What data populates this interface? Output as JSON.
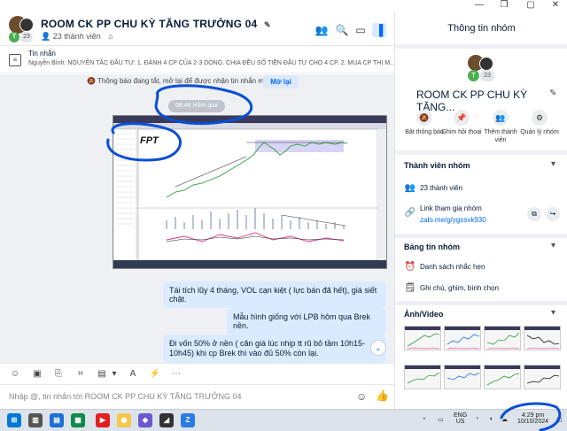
{
  "chat": {
    "title": "ROOM CK PP CHU KỲ TĂNG TRƯỞNG 04",
    "avatar_initial": "T",
    "avatar_count": "23",
    "member_count": "23 thành viên",
    "pinned_title": "Tin nhắn",
    "pinned_text": "Nguyễn Bình: NGUYÊN TẮC ĐẦU TƯ: 1. ĐÁNH 4 CP CỦA 2-3 DÒNG. CHIA ĐỀU SỐ TIỀN ĐẦU TƯ CHO 4 CP. 2. MUA CP THỊ M...",
    "notification_text": "Thông báo đang tắt, mở lại để được nhận tin nhắn mới",
    "notification_button": "Mở lại",
    "time_divider": "08:46 Hôm qua",
    "chart_ticker": "FPT",
    "messages": [
      "Tái tích lũy 4 tháng, VOL cạn kiệt ( lực bán đã hết), giá siết chặt.",
      "Mẫu hình giống với LPB hôm qua Brek nền.",
      "Đi vốn 50% ở nền ( căn giá lúc nhịp tt rũ bỏ tầm 10h15-10h45) khi cp Brek thì vào đủ 50% còn lại."
    ],
    "input_placeholder": "Nhập @, tin nhắn tới ROOM CK PP CHU KỲ TĂNG TRƯỞNG 04"
  },
  "panel": {
    "title": "Thông tin nhóm",
    "group_name": "ROOM CK PP CHU KỲ TĂNG...",
    "actions": [
      {
        "label": "Bật thông báo",
        "icon": "bell-off-icon"
      },
      {
        "label": "Ghim hội thoại",
        "icon": "pin-icon"
      },
      {
        "label": "Thêm thành viên",
        "icon": "add-user-icon"
      },
      {
        "label": "Quản lý nhóm",
        "icon": "gear-icon"
      }
    ],
    "members_section": "Thành viên nhóm",
    "members_count": "23 thành viên",
    "join_link_label": "Link tham gia nhóm",
    "join_link": "zalo.me/g/ygssvk930",
    "board_section": "Bảng tin nhóm",
    "reminders": "Danh sách nhắc hẹn",
    "notes": "Ghi chú, ghim, bình chọn",
    "media_section": "Ảnh/Video"
  },
  "taskbar": {
    "language": "ENG",
    "region": "US",
    "time": "4:29 pm",
    "date": "10/10/2024"
  },
  "colors": {
    "accent": "#0068ff",
    "bubble": "#dbebff",
    "chat_bg": "#eef0f4",
    "annotation": "#0a4fd6"
  }
}
